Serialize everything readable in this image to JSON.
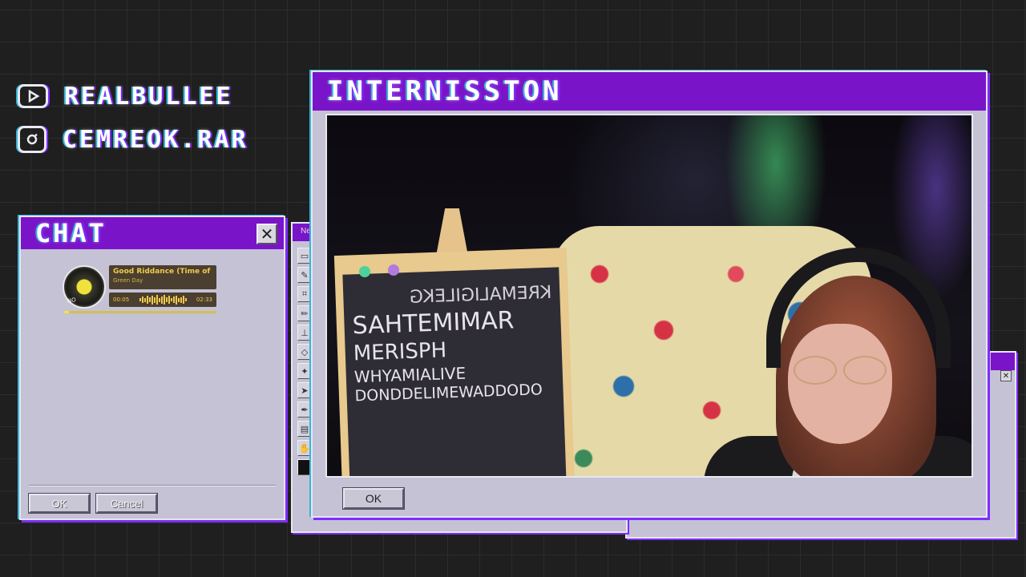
{
  "social": {
    "youtube_handle": "REALBULLEE",
    "instagram_handle": "CEMREOK.RAR"
  },
  "chat_window": {
    "title": "CHAT",
    "close_glyph": "✕",
    "ok_label": "OK",
    "cancel_label": "Cancel"
  },
  "music_widget": {
    "track_title": "Good Riddance (Time of You",
    "artist": "Green Day",
    "elapsed": "00:05",
    "duration": "02:33",
    "progress_fraction": 0.03
  },
  "main_window": {
    "title": "INTERNISSTON",
    "ok_label": "OK"
  },
  "tool_window": {
    "title": "Ne"
  },
  "chalkboard": {
    "lines": [
      "KREMALIGILEKG",
      "SAHTEMIMAR",
      "MERISPH",
      "WHYAMIALIVE",
      "DONDDELIMEWADDODO"
    ]
  },
  "colors": {
    "accent_purple": "#7a14c9",
    "window_gray": "#c4c2d4",
    "music_gold": "#f3c94b"
  },
  "icons": [
    "youtube-icon",
    "instagram-icon",
    "close-icon",
    "album-art-icon"
  ]
}
